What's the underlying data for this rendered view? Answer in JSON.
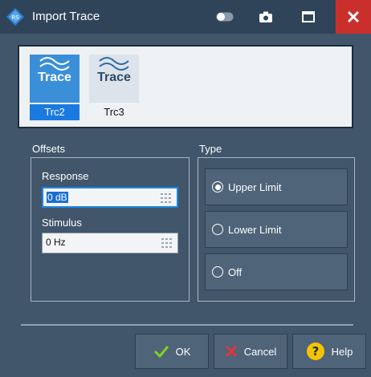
{
  "window": {
    "title": "Import Trace"
  },
  "traces": [
    {
      "word": "Trace",
      "name": "Trc2",
      "selected": true
    },
    {
      "word": "Trace",
      "name": "Trc3",
      "selected": false
    }
  ],
  "offsets": {
    "label": "Offsets",
    "response": {
      "label": "Response",
      "value": "0 dB"
    },
    "stimulus": {
      "label": "Stimulus",
      "value": "0 Hz"
    }
  },
  "type": {
    "label": "Type",
    "options": [
      {
        "label": "Upper Limit",
        "selected": true
      },
      {
        "label": "Lower Limit",
        "selected": false
      },
      {
        "label": "Off",
        "selected": false
      }
    ]
  },
  "buttons": {
    "ok": "OK",
    "cancel": "Cancel",
    "help": "Help"
  },
  "colors": {
    "titlebar": "#2f4458",
    "background": "#41566b",
    "close": "#c9302c",
    "accent": "#1a7ae0"
  }
}
